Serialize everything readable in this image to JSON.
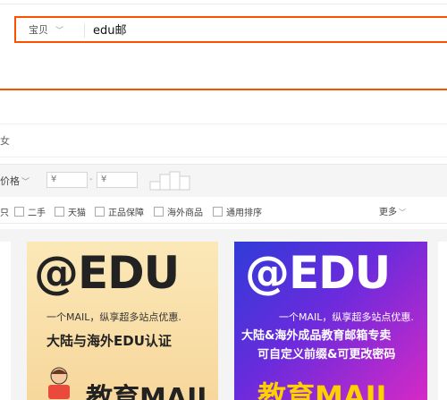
{
  "search": {
    "scope_label": "宝贝",
    "query": "edu邮"
  },
  "related": {
    "text": "女"
  },
  "filter": {
    "price_label": "价格",
    "price_min_placeholder": "¥",
    "price_max_placeholder": "¥",
    "dash": "-"
  },
  "options": {
    "items": [
      "只",
      "二手",
      "天猫",
      "正品保障",
      "海外商品",
      "通用排序"
    ],
    "more_label": "更多"
  },
  "products": [
    {
      "headline": "@EDU",
      "tagline": "一个MAIL，纵享超多站点优惠.",
      "slogan": "大陆与海外EDU认证",
      "big_text": "教育MAIL"
    },
    {
      "headline": "@EDU",
      "tagline": "一个MAIL，纵享超多站点优惠.",
      "slogan_line1": "大陆&海外成品教育邮箱专卖",
      "slogan_line2": "可自定义前缀&可更改密码",
      "big_text": "教育MAIL"
    }
  ],
  "colors": {
    "accent": "#ff5000",
    "filter_bg": "#f5f5f5"
  }
}
